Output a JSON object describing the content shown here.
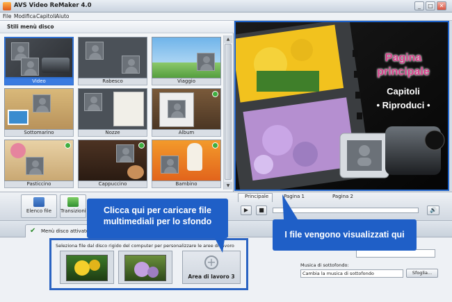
{
  "window": {
    "title": "AVS Video ReMaker 4.0",
    "controls": [
      "_",
      "□",
      "✕"
    ]
  },
  "menu": [
    "File",
    "Modifica",
    "Capitoli",
    "Aiuto"
  ],
  "styles_panel": {
    "header": "Stili menù disco",
    "selected": "Video",
    "tiles": [
      "Video",
      "Rabesco",
      "Viaggio",
      "Sottomarino",
      "Nozze",
      "Album",
      "Pasticcino",
      "Cappuccino",
      "Bambino"
    ]
  },
  "preview": {
    "title_line1": "Pagina",
    "title_line2": "principale",
    "chapters": "Capitoli",
    "play": "• Riproduci •"
  },
  "pages_tabs": [
    "Principale",
    "Pagina 1",
    "Pagina 2"
  ],
  "toolbar": {
    "file_list": "Elenco file",
    "transitions": "Transizioni"
  },
  "bottom": {
    "tab_label": "Menù disco attivato",
    "instruction": "Seleziona file dal disco rigido del computer per personalizzare le aree di lavoro",
    "workspace3": "Area di lavoro 3",
    "music_label": "Musica di sottofondo:",
    "music_value": "Cambia la musica di sottofondo",
    "browse": "Sfoglia..."
  },
  "callouts": {
    "left": "Clicca qui per caricare file multimediali per lo sfondo",
    "right": "I file vengono visualizzati qui"
  },
  "colors": {
    "accent": "#1f5fc7",
    "selection": "#3a7be0"
  }
}
